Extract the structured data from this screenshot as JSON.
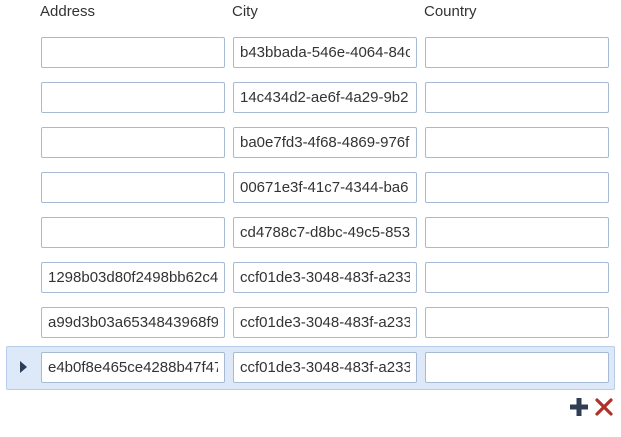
{
  "columns": {
    "address": "Address",
    "city": "City",
    "country": "Country"
  },
  "rows": [
    {
      "address": "",
      "city": "b43bbada-546e-4064-84c",
      "country": ""
    },
    {
      "address": "",
      "city": "14c434d2-ae6f-4a29-9b2",
      "country": ""
    },
    {
      "address": "",
      "city": "ba0e7fd3-4f68-4869-976f",
      "country": ""
    },
    {
      "address": "",
      "city": "00671e3f-41c7-4344-ba6",
      "country": ""
    },
    {
      "address": "",
      "city": "cd4788c7-d8bc-49c5-853",
      "country": ""
    },
    {
      "address": "1298b03d80f2498bb62c4",
      "city": "ccf01de3-3048-483f-a233",
      "country": ""
    },
    {
      "address": "a99d3b03a6534843968f9",
      "city": "ccf01de3-3048-483f-a233",
      "country": ""
    },
    {
      "address": "e4b0f8e465ce4288b47f47",
      "city": "ccf01de3-3048-483f-a233",
      "country": ""
    }
  ],
  "selected_row": 7,
  "icons": {
    "add": "plus-icon",
    "delete": "x-icon"
  },
  "colors": {
    "add_icon": "#2f3e52",
    "delete_icon": "#b0302a",
    "selected_row_bg": "#dde9f8",
    "cell_border": "#a6bad3"
  }
}
